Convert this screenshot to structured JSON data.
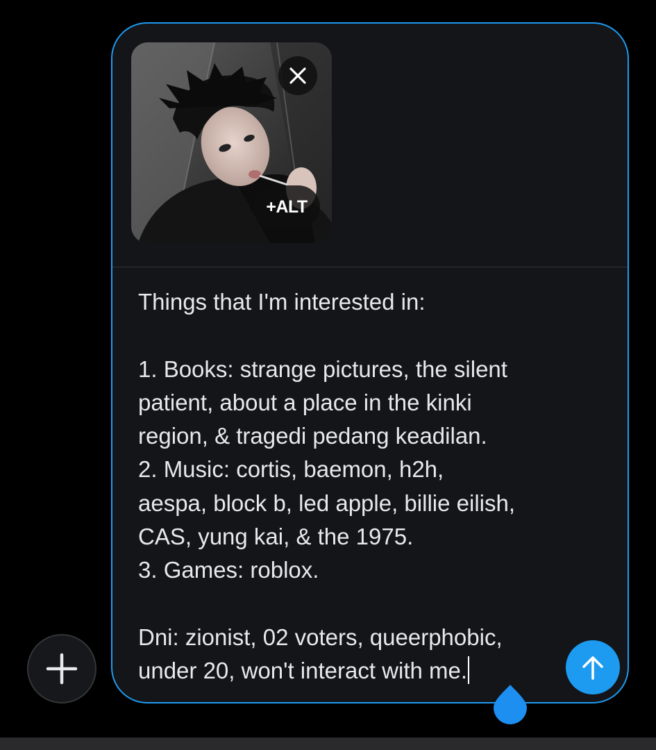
{
  "composer": {
    "image": {
      "alt_button_label": "+ALT",
      "remove_icon": "close-icon"
    },
    "text_lines": [
      "Things that I'm interested in:",
      "",
      "1. Books: strange pictures, the silent",
      "patient, about a place in the kinki",
      "region, & tragedi pedang keadilan.",
      "2. Music: cortis, baemon, h2h,",
      "aespa, block b, led apple, billie eilish,",
      "CAS, yung kai, & the 1975.",
      "3. Games: roblox.",
      "",
      "Dni: zionist, 02 voters, queerphobic,",
      "under 20, won't interact with me."
    ],
    "send_icon": "arrow-up-icon"
  },
  "add_button_icon": "plus-icon",
  "colors": {
    "accent": "#1d9bf0",
    "background": "#000000",
    "composer_bg": "#141519",
    "text": "#e7e9ea"
  }
}
